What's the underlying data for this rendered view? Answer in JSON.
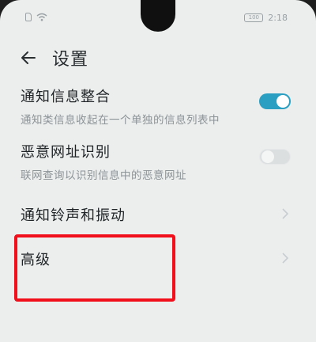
{
  "status_bar": {
    "battery": "100",
    "time": "2:18"
  },
  "header": {
    "title": "设置"
  },
  "settings": [
    {
      "title": "通知信息整合",
      "subtitle": "通知类信息收起在一个单独的信息列表中",
      "control": "toggle",
      "state": "on"
    },
    {
      "title": "恶意网址识别",
      "subtitle": "联网查询以识别信息中的恶意网址",
      "control": "toggle",
      "state": "off"
    },
    {
      "title": "通知铃声和振动",
      "control": "chevron"
    },
    {
      "title": "高级",
      "control": "chevron"
    }
  ],
  "colors": {
    "accent": "#2a9fc2",
    "highlight": "#f20f1c",
    "background": "#eceeee"
  },
  "icons": [
    "sim-icon",
    "wifi-icon",
    "battery-icon",
    "back-icon",
    "chevron-icon"
  ]
}
